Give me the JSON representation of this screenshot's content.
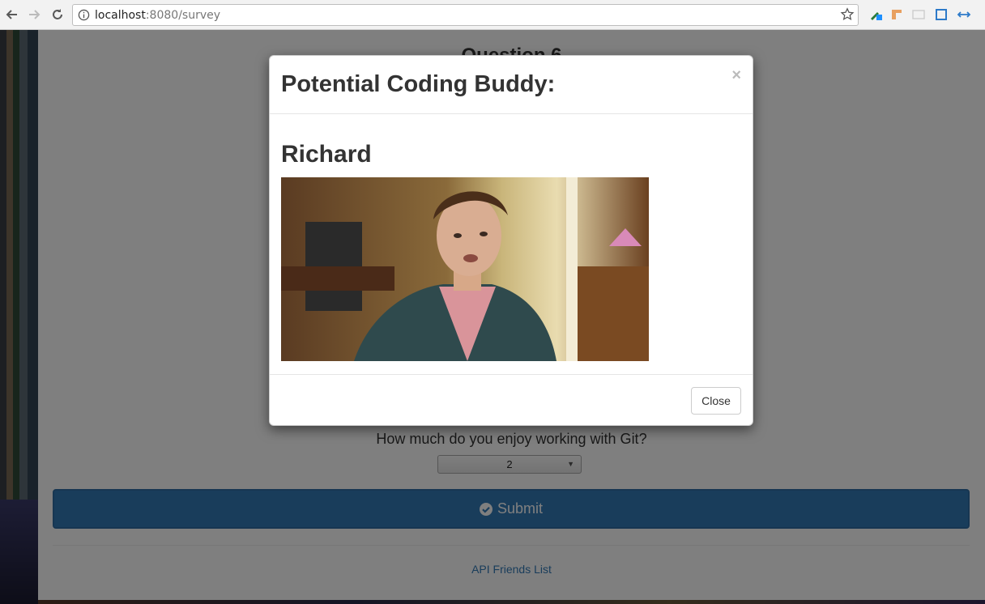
{
  "browser": {
    "url_host": "localhost",
    "url_path": ":8080/survey",
    "icons": [
      "back-icon",
      "forward-icon",
      "reload-icon",
      "info-icon",
      "star-icon"
    ]
  },
  "page": {
    "question_title": "Question 6",
    "question_text": "How much do you enjoy working with Git?",
    "select_value": "2",
    "submit_label": "Submit",
    "api_link": "API Friends List"
  },
  "modal": {
    "title": "Potential Coding Buddy:",
    "close_x": "×",
    "name": "Richard",
    "photo_alt": "Richard",
    "close_button": "Close"
  },
  "colors": {
    "primary": "#337ab7",
    "text": "#333333"
  }
}
